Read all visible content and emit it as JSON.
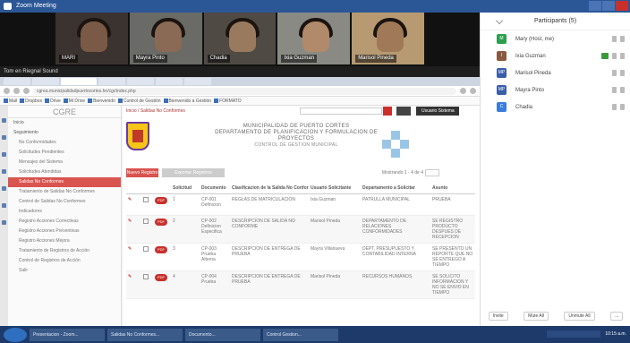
{
  "zoom": {
    "title": "Zoom Meeting",
    "share_bar": "Tom en Riegnal Sound",
    "tiles": [
      {
        "name": "MARI"
      },
      {
        "name": "Mayra Pinto"
      },
      {
        "name": "Chadia"
      },
      {
        "name": "Ixia Guzman"
      },
      {
        "name": "Marisol Pineda"
      }
    ]
  },
  "browser": {
    "url": "cgrea.municipalidadpuertocortes.hn/cgr/index.php",
    "bookmarks": [
      "Mail",
      "Dropbox",
      "Drive",
      "Mi Drive",
      "Bienvenido",
      "Control de Gestión",
      "Bienvenido a Gestión",
      "FORMATO"
    ]
  },
  "app": {
    "brand": "CGRE",
    "sidebar": {
      "sections": [
        {
          "label": "Inicio",
          "head": true
        },
        {
          "label": "Seguimiento",
          "head": true
        },
        {
          "label": "No Conformidades"
        },
        {
          "label": "Solicitudes Pendientes"
        },
        {
          "label": "Mensajes del Sistema"
        },
        {
          "label": "Solicitudes Atendidas"
        },
        {
          "label": "Salidas No Conformes",
          "active": true
        },
        {
          "label": "Tratamiento de Salidas No Conformes"
        },
        {
          "label": "Control de Salidas No Conformes"
        },
        {
          "label": "Indicadores"
        },
        {
          "label": "Registro Acciones Correctivas"
        },
        {
          "label": "Registro Acciones Preventivas"
        },
        {
          "label": "Registro Acciones Mejora"
        },
        {
          "label": "Tratamiento de Registros de Acción"
        },
        {
          "label": "Control de Registros de Acción"
        },
        {
          "label": "Salir"
        }
      ]
    },
    "topnav": {
      "breadcrumb": "Inicio / Salidas No Conformes",
      "user_label": "Usuario Sistema"
    },
    "header": {
      "line1": "MUNICIPALIDAD DE PUERTO CORTES",
      "line2": "DEPARTAMENTO DE PLANIFICACION Y FORMULACION DE",
      "line3": "PROYECTOS",
      "line4": "CONTROL DE GESTION MUNICIPAL"
    },
    "toolbar": {
      "new_label": "Nuevo Registro",
      "gray_label": "Exportar Registros Seleccionados",
      "show_label": "Mostrando 1 - 4 de 4"
    },
    "table": {
      "headers": [
        "",
        "",
        "",
        "Solicitud",
        "Documento",
        "Clasificacion de la Salida No Conforme",
        "Usuario Solicitante",
        "Departamento a Solicitar",
        "Asunto"
      ],
      "rows": [
        {
          "num": "1",
          "doc": "CP-001 Definicion",
          "clasif": "REGLAS DE MATRICULACION",
          "user": "Ixia Guzman",
          "dept": "PATRULLA MUNICIPAL",
          "asunto": "PRUEBA"
        },
        {
          "num": "2",
          "doc": "CP-002 Definicion Especifica",
          "clasif": "DESCRIPCION DE SALIDA NO CONFORME",
          "user": "Marisol Pineda",
          "dept": "DEPARTAMENTO DE RELACIONES CONFORMIDADES",
          "asunto": "SE REGISTRO PRODUCTO DESPUES DE RECEPCION"
        },
        {
          "num": "3",
          "doc": "CP-003 Prueba Alterna",
          "clasif": "DESCRIPCION DE ENTREGA DE PRUEBA",
          "user": "Mayra Villanueva",
          "dept": "DEPT. PRESUPUESTO Y CONTABILIDAD INTERNA",
          "asunto": "SE PRESENTO UN REPORTE QUE NO SE ENTREGO A TIEMPO"
        },
        {
          "num": "4",
          "doc": "CP-004 Prueba",
          "clasif": "DESCRIPCION DE ENTREGA DE PRUEBA",
          "user": "Marisol Pineda",
          "dept": "RECURSOS HUMANOS",
          "asunto": "SE SOLICITO INFORMACION Y NO SE ENVIO EN TIEMPO"
        }
      ]
    }
  },
  "participants": {
    "title": "Participants (5)",
    "list": [
      {
        "initial": "M",
        "name": "Mary (Host, me)",
        "color": "#2e9e4f"
      },
      {
        "initial": "I",
        "name": "Ixia Guzman",
        "color": "#8a5a40"
      },
      {
        "initial": "MP",
        "name": "Marisol Pineda",
        "color": "#3b5ea8"
      },
      {
        "initial": "MP",
        "name": "Mayra Pinto",
        "color": "#3b5ea8"
      },
      {
        "initial": "C",
        "name": "Chadia",
        "color": "#3b7dd8"
      }
    ],
    "footer": [
      "Invite",
      "Mute All",
      "Unmute All",
      "..."
    ]
  },
  "taskbar": {
    "items": [
      "Presentacion - Zoom...",
      "Salidas No Conformes...",
      "Documento...",
      "Control Gestion..."
    ],
    "clock": "10:15 a.m."
  }
}
